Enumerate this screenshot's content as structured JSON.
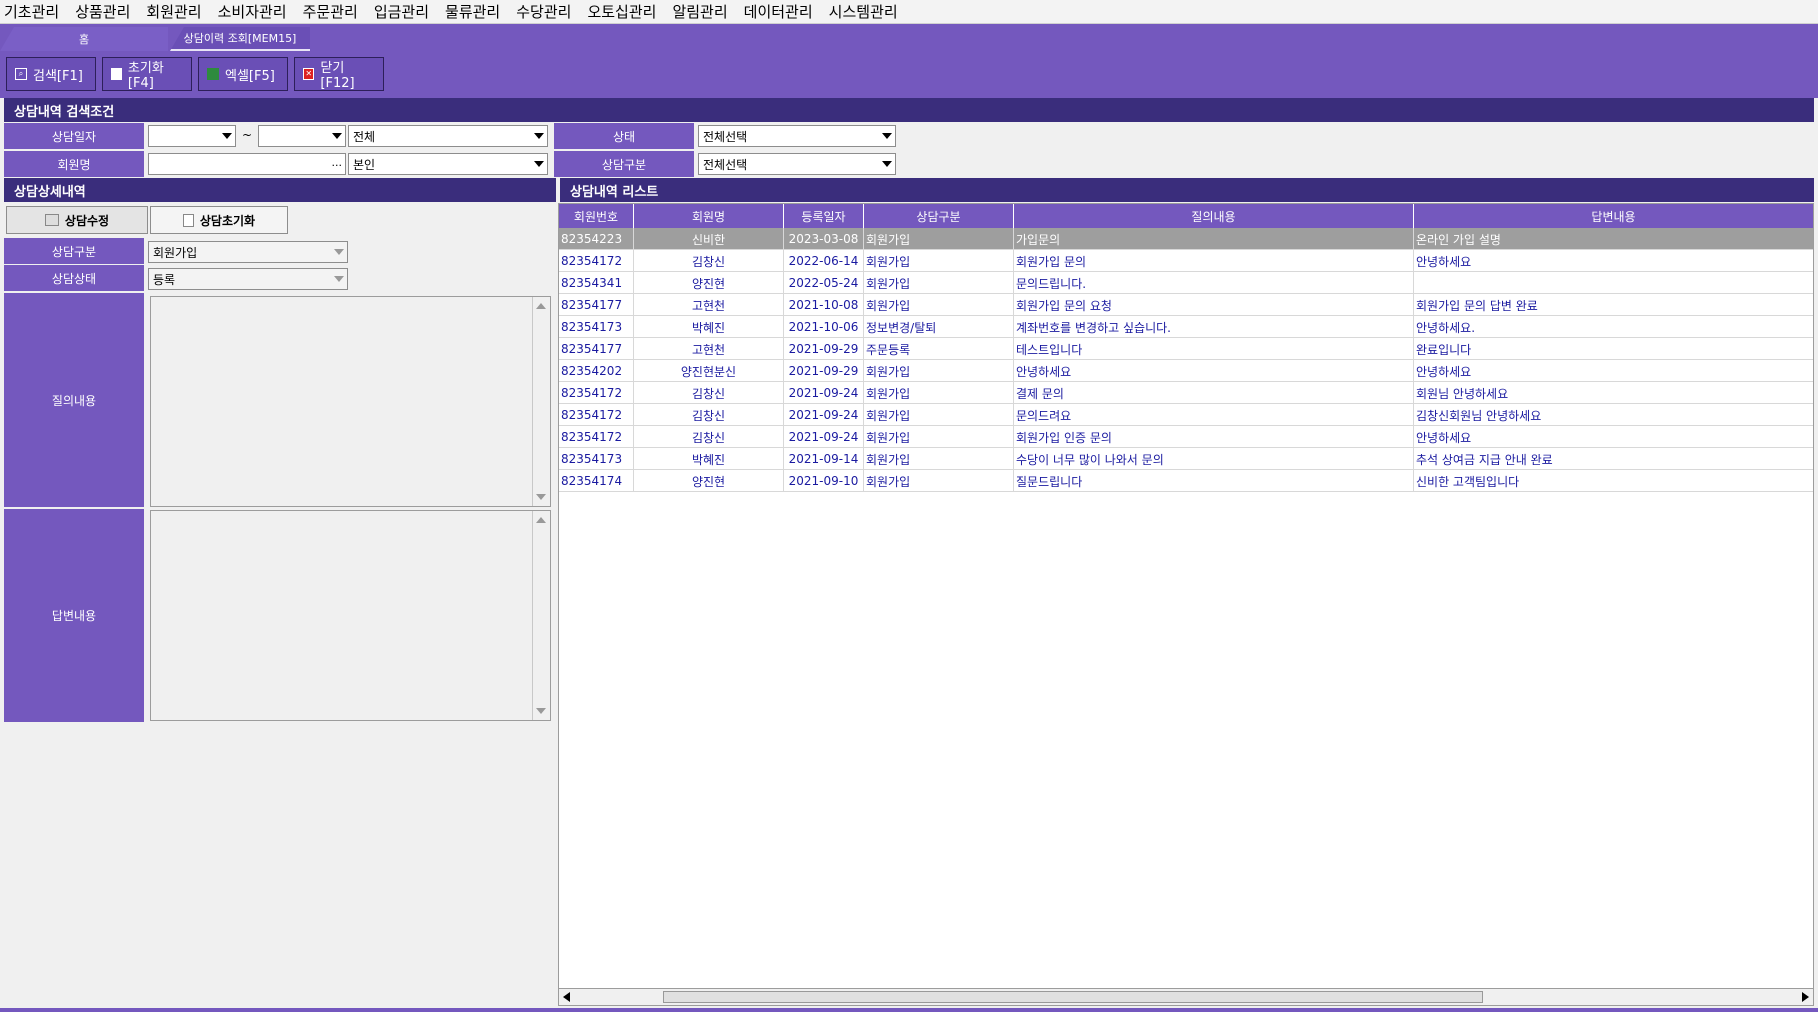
{
  "menu": [
    "기초관리",
    "상품관리",
    "회원관리",
    "소비자관리",
    "주문관리",
    "입금관리",
    "물류관리",
    "수당관리",
    "오토십관리",
    "알림관리",
    "데이터관리",
    "시스템관리"
  ],
  "tabs": {
    "home": "홈",
    "active": "상담이력 조회[MEM15]"
  },
  "toolbar": {
    "search": "검색[F1]",
    "reset": "초기화[F4]",
    "excel": "엑셀[F5]",
    "close": "닫기[F12]"
  },
  "search": {
    "title": "상담내역 검색조건",
    "date_label": "상담일자",
    "tilde": "~",
    "date_from": "",
    "date_to": "",
    "date_type": "전체",
    "status_label": "상태",
    "status_value": "전체선택",
    "member_label": "회원명",
    "member_value": "",
    "ellipsis": "...",
    "member_scope": "본인",
    "type_label": "상담구분",
    "type_value": "전체선택"
  },
  "detail": {
    "title": "상담상세내역",
    "edit_button": "상담수정",
    "clear_button": "상담초기화",
    "type_label": "상담구분",
    "type_value": "회원가입",
    "status_label": "상담상태",
    "status_value": "등록",
    "question_label": "질의내용",
    "answer_label": "답변내용"
  },
  "list": {
    "title": "상담내역 리스트",
    "columns": [
      "회원번호",
      "회원명",
      "등록일자",
      "상담구분",
      "질의내용",
      "답변내용"
    ],
    "rows": [
      [
        "82354223",
        "신비한",
        "2023-03-08",
        "회원가입",
        "가입문의",
        "온라인 가입 설명"
      ],
      [
        "82354172",
        "김창신",
        "2022-06-14",
        "회원가입",
        "회원가입 문의",
        "안녕하세요"
      ],
      [
        "82354341",
        "양진현",
        "2022-05-24",
        "회원가입",
        "문의드립니다.",
        ""
      ],
      [
        "82354177",
        "고현천",
        "2021-10-08",
        "회원가입",
        "회원가입 문의 요청",
        "회원가입 문의 답변 완료"
      ],
      [
        "82354173",
        "박혜진",
        "2021-10-06",
        "정보변경/탈퇴",
        "계좌번호를 변경하고 싶습니다.",
        "안녕하세요."
      ],
      [
        "82354177",
        "고현천",
        "2021-09-29",
        "주문등록",
        "테스트입니다",
        "완료입니다"
      ],
      [
        "82354202",
        "양진현분신",
        "2021-09-29",
        "회원가입",
        "안녕하세요",
        "안녕하세요"
      ],
      [
        "82354172",
        "김창신",
        "2021-09-24",
        "회원가입",
        "결제 문의",
        "회원님 안녕하세요"
      ],
      [
        "82354172",
        "김창신",
        "2021-09-24",
        "회원가입",
        "문의드려요",
        "김창신회원님 안녕하세요"
      ],
      [
        "82354172",
        "김창신",
        "2021-09-24",
        "회원가입",
        "회원가입 인증 문의",
        "안녕하세요"
      ],
      [
        "82354173",
        "박혜진",
        "2021-09-14",
        "회원가입",
        "수당이 너무 많이 나와서 문의",
        "추석 상여금 지급 안내 완료"
      ],
      [
        "82354174",
        "양진현",
        "2021-09-10",
        "회원가입",
        "질문드립니다",
        "신비한 고객팀입니다"
      ]
    ]
  },
  "colors": {
    "accent": "#7458be",
    "header_dark": "#3a2d7c",
    "selected_row": "#9e9e9e",
    "cell_text": "#1a1aa0"
  }
}
